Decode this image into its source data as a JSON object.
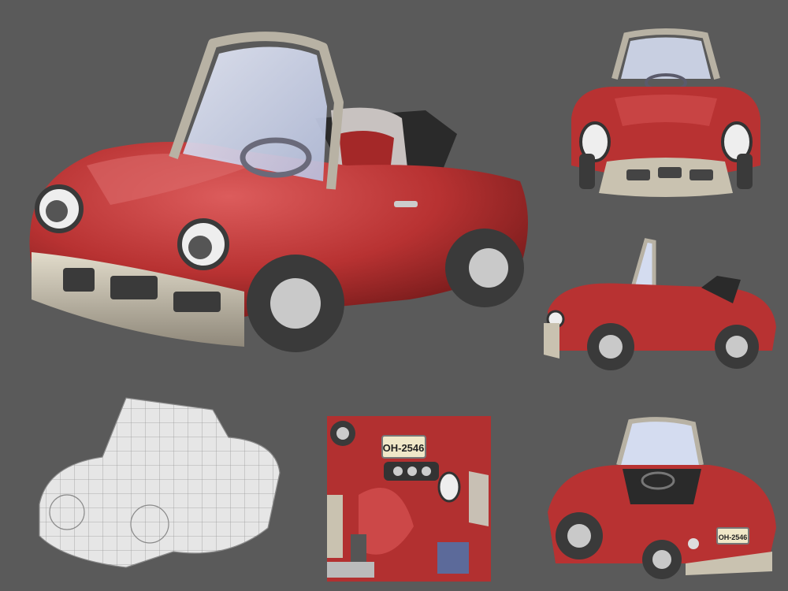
{
  "texture_atlas": {
    "plate_text": "OH-2546"
  },
  "rear_view": {
    "plate_text": "OH-2546"
  },
  "colors": {
    "background": "#5a5a5a",
    "body_red": "#b83232",
    "body_highlight": "#d85a5a",
    "chrome": "#c9c2b0",
    "tire": "#3a3a3a",
    "glass": "#d4dcf0",
    "wireframe": "#e8e8e8"
  }
}
